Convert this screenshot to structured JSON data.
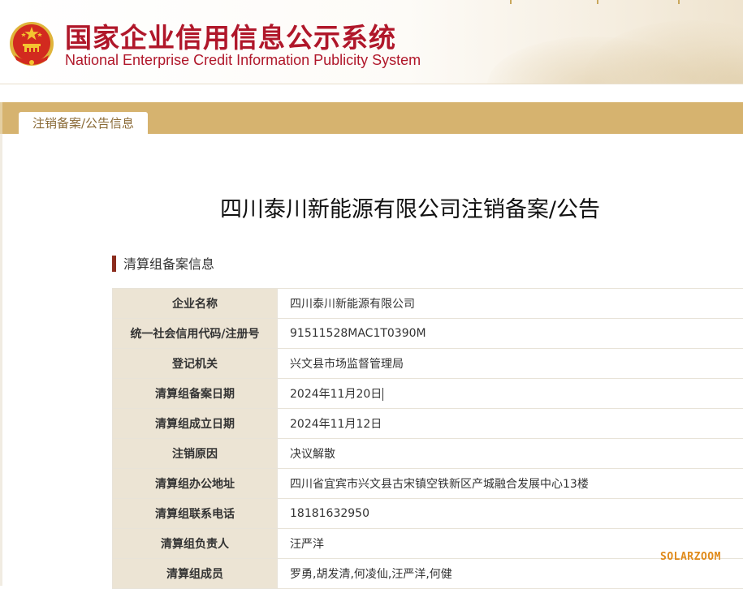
{
  "header": {
    "title_cn": "国家企业信用信息公示系统",
    "title_en": "National Enterprise Credit Information Publicity System",
    "emblem_icon": "national-emblem-icon"
  },
  "tab": {
    "label": "注销备案/公告信息"
  },
  "notice": {
    "title": "四川泰川新能源有限公司注销备案/公告",
    "section_heading": "清算组备案信息"
  },
  "info_rows": [
    {
      "label": "企业名称",
      "value": "四川泰川新能源有限公司"
    },
    {
      "label": "统一社会信用代码/注册号",
      "value": "91511528MAC1T0390M"
    },
    {
      "label": "登记机关",
      "value": "兴文县市场监督管理局"
    },
    {
      "label": "清算组备案日期",
      "value": "2024年11月20日"
    },
    {
      "label": "清算组成立日期",
      "value": "2024年11月12日"
    },
    {
      "label": "注销原因",
      "value": "决议解散"
    },
    {
      "label": "清算组办公地址",
      "value": "四川省宜宾市兴文县古宋镇空铁新区产城融合发展中心13楼"
    },
    {
      "label": "清算组联系电话",
      "value": "18181632950"
    },
    {
      "label": "清算组负责人",
      "value": "汪严洋"
    },
    {
      "label": "清算组成员",
      "value": "罗勇,胡发清,何凌仙,汪严洋,何健"
    }
  ],
  "watermark": "SOLARZOOM",
  "colors": {
    "brand_red": "#b0172a",
    "tab_band": "#d6b36f",
    "label_bg": "#ece4d4",
    "section_marker": "#8b2c1d",
    "watermark": "#e08a1a"
  }
}
